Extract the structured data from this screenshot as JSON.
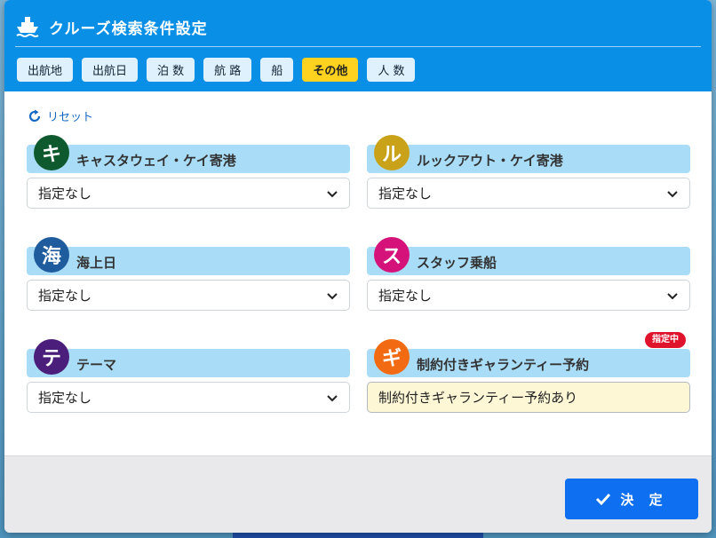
{
  "modal": {
    "title": "クルーズ検索条件設定",
    "tabs": [
      {
        "label": "出航地",
        "active": false
      },
      {
        "label": "出航日",
        "active": false
      },
      {
        "label": "泊 数",
        "active": false
      },
      {
        "label": "航 路",
        "active": false
      },
      {
        "label": "船",
        "active": false
      },
      {
        "label": "その他",
        "active": true
      },
      {
        "label": "人 数",
        "active": false
      }
    ],
    "reset_label": "リセット",
    "filters": [
      {
        "badge": "キ",
        "badge_color": "#0e5a2e",
        "label": "キャスタウェイ・ケイ寄港",
        "value": "指定なし"
      },
      {
        "badge": "ル",
        "badge_color": "#c9a21a",
        "label": "ルックアウト・ケイ寄港",
        "value": "指定なし"
      },
      {
        "badge": "海",
        "badge_color": "#1f5c9e",
        "label": "海上日",
        "value": "指定なし"
      },
      {
        "badge": "ス",
        "badge_color": "#d4127a",
        "label": "スタッフ乗船",
        "value": "指定なし"
      },
      {
        "badge": "テ",
        "badge_color": "#4a1e7a",
        "label": "テーマ",
        "value": "指定なし"
      },
      {
        "badge": "ギ",
        "badge_color": "#f26a12",
        "label": "制約付きギャランティー予約",
        "value": "制約付きギャランティー予約あり",
        "status": "指定中"
      }
    ],
    "confirm_label": "決 定"
  },
  "colors": {
    "header": "#0a8fe6",
    "tab_active": "#ffd21f",
    "card_head": "#a9ddf7",
    "confirm": "#0e6ff0",
    "status_pill": "#e0132d"
  }
}
